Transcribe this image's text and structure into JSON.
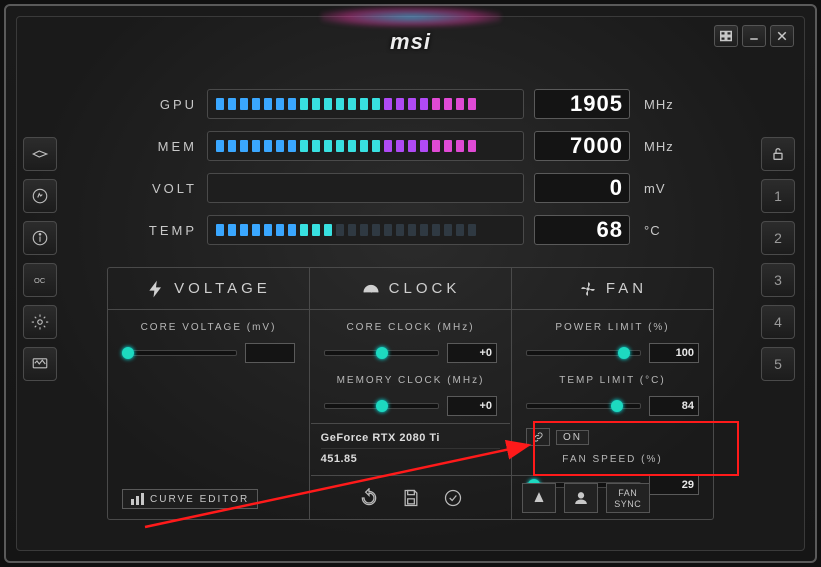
{
  "brand": "msi",
  "window": {
    "close": "×",
    "min": "—"
  },
  "metrics": {
    "gpu": {
      "label": "GPU",
      "value": "1905",
      "unit": "MHz"
    },
    "mem": {
      "label": "MEM",
      "value": "7000",
      "unit": "MHz"
    },
    "volt": {
      "label": "VOLT",
      "value": "0",
      "unit": "mV"
    },
    "temp": {
      "label": "TEMP",
      "value": "68",
      "unit": "°C"
    }
  },
  "tabs": {
    "voltage": "VOLTAGE",
    "clock": "CLOCK",
    "fan": "FAN"
  },
  "voltage": {
    "core_label": "CORE VOLTAGE (mV)",
    "core_value": "",
    "curve_editor": "CURVE EDITOR"
  },
  "clock": {
    "core_label": "CORE CLOCK (MHz)",
    "core_value": "+0",
    "mem_label": "MEMORY CLOCK (MHz)",
    "mem_value": "+0"
  },
  "fan": {
    "power_label": "POWER LIMIT (%)",
    "power_value": "100",
    "temp_label": "TEMP LIMIT (°C)",
    "temp_value": "84",
    "link_state": "ON",
    "speed_label": "FAN SPEED (%)",
    "speed_value": "29",
    "sync": "FAN\nSYNC"
  },
  "gpu": {
    "name": "GeForce RTX 2080 Ti",
    "driver": "451.85"
  },
  "profiles": [
    "1",
    "2",
    "3",
    "4",
    "5"
  ]
}
